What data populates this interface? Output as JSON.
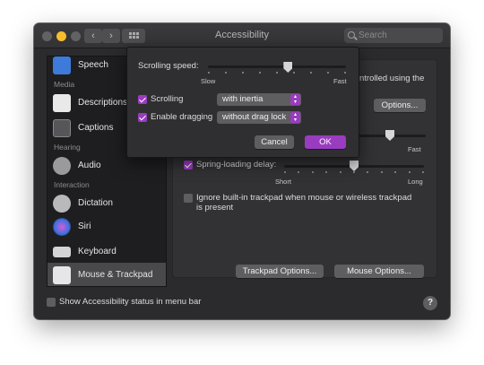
{
  "window": {
    "title": "Accessibility"
  },
  "search": {
    "placeholder": "Search"
  },
  "nav": {
    "back": "‹",
    "forward": "›"
  },
  "sidebar": {
    "items": [
      {
        "label": "Speech",
        "icon": "speech-icon"
      },
      {
        "label": "Descriptions",
        "icon": "descriptions-icon"
      },
      {
        "label": "Captions",
        "icon": "captions-icon"
      },
      {
        "label": "Audio",
        "icon": "audio-icon"
      },
      {
        "label": "Dictation",
        "icon": "dictation-icon"
      },
      {
        "label": "Siri",
        "icon": "siri-icon"
      },
      {
        "label": "Keyboard",
        "icon": "keyboard-icon"
      },
      {
        "label": "Mouse & Trackpad",
        "icon": "mouse-trackpad-icon",
        "selected": true
      }
    ],
    "headers": {
      "media": "Media",
      "hearing": "Hearing",
      "interaction": "Interaction"
    }
  },
  "main": {
    "partial_text": "ntrolled using the",
    "options_button": "Options...",
    "fast_label_partial": "Fast",
    "spring_loading": {
      "label": "Spring-loading delay:",
      "checked": true,
      "value": 0.5,
      "min_label": "Short",
      "max_label": "Long"
    },
    "ignore_trackpad": {
      "label_line1": "Ignore built-in trackpad when mouse or wireless trackpad",
      "label_line2": "is present",
      "checked": false
    },
    "trackpad_options_button": "Trackpad Options...",
    "mouse_options_button": "Mouse Options..."
  },
  "popover": {
    "scrolling_speed": {
      "label": "Scrolling speed:",
      "min_label": "Slow",
      "max_label": "Fast",
      "value": 0.58
    },
    "scrolling": {
      "label": "Scrolling",
      "checked": true,
      "selected": "with inertia"
    },
    "dragging": {
      "label": "Enable dragging",
      "checked": true,
      "selected": "without drag lock"
    },
    "cancel": "Cancel",
    "ok": "OK"
  },
  "footer": {
    "status_label": "Show Accessibility status in menu bar",
    "checked": false,
    "help": "?"
  },
  "colors": {
    "accent": "#9a3cc0",
    "window_bg": "#2b2b2d",
    "sidebar_bg": "#1e1e20"
  }
}
